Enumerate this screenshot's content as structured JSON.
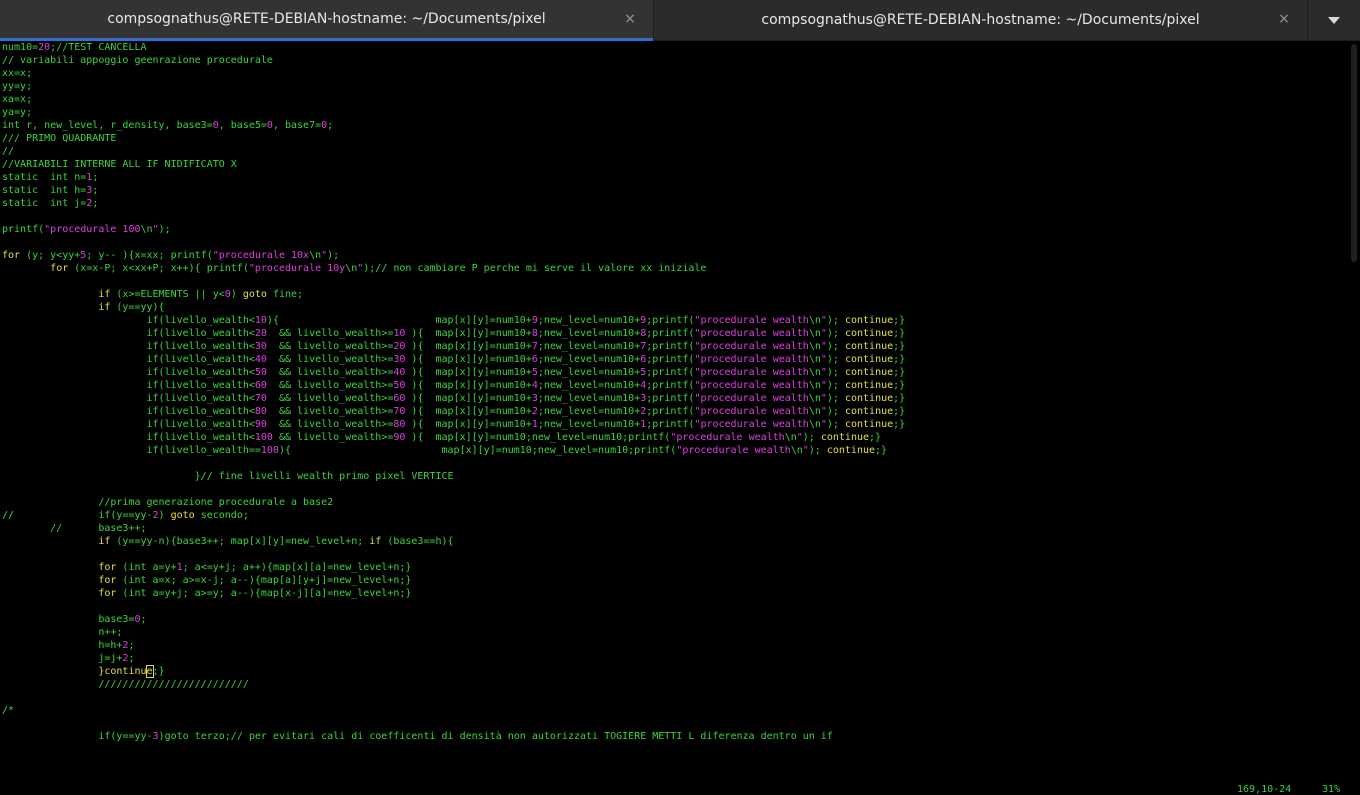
{
  "tabs": [
    {
      "title": "compsognathus@RETE-DEBIAN-hostname: ~/Documents/pixel",
      "close": "×",
      "active": true
    },
    {
      "title": "compsognathus@RETE-DEBIAN-hostname: ~/Documents/pixel",
      "close": "×",
      "active": false
    }
  ],
  "menu_icon": "chevron-down-icon",
  "colors": {
    "default": "#3ad53a",
    "number": "#e03ee0",
    "string": "#e03ee0",
    "keyword": "#e0e040",
    "comment": "#3ad53a",
    "active_tab_underline": "#2f6fd0"
  },
  "editor": {
    "lines": [
      [
        [
          "num10=",
          "d"
        ],
        [
          "20",
          "n"
        ],
        [
          ";//TEST CANCELLA",
          "d"
        ]
      ],
      [
        [
          "// variabili appoggio geenrazione procedurale",
          "d"
        ]
      ],
      [
        [
          "xx=x;",
          "d"
        ]
      ],
      [
        [
          "yy=y;",
          "d"
        ]
      ],
      [
        [
          "xa=x;",
          "d"
        ]
      ],
      [
        [
          "ya=y;",
          "d"
        ]
      ],
      [
        [
          "int r, new_level, r_density, base3=",
          "d"
        ],
        [
          "0",
          "n"
        ],
        [
          ", base5=",
          "d"
        ],
        [
          "0",
          "n"
        ],
        [
          ", base7=",
          "d"
        ],
        [
          "0",
          "n"
        ],
        [
          ";",
          "d"
        ]
      ],
      [
        [
          "/// PRIMO QUADRANTE",
          "d"
        ]
      ],
      [
        [
          "//",
          "d"
        ]
      ],
      [
        [
          "//VARIABILI INTERNE ALL IF NIDIFICATO X",
          "d"
        ]
      ],
      [
        [
          "static  int n=",
          "d"
        ],
        [
          "1",
          "n"
        ],
        [
          ";",
          "d"
        ]
      ],
      [
        [
          "static  int h=",
          "d"
        ],
        [
          "3",
          "n"
        ],
        [
          ";",
          "d"
        ]
      ],
      [
        [
          "static  int j=",
          "d"
        ],
        [
          "2",
          "n"
        ],
        [
          ";",
          "d"
        ]
      ],
      [
        [
          "",
          "d"
        ]
      ],
      [
        [
          "printf(",
          "d"
        ],
        [
          "\"procedurale 100",
          "s"
        ],
        [
          "\\n",
          "d"
        ],
        [
          "\"",
          "s"
        ],
        [
          ");",
          "d"
        ]
      ],
      [
        [
          "",
          "d"
        ]
      ],
      [
        [
          "for",
          "k"
        ],
        [
          " (y; y<yy+",
          "d"
        ],
        [
          "5",
          "n"
        ],
        [
          "; y-- ){x=xx; printf(",
          "d"
        ],
        [
          "\"procedurale 10x",
          "s"
        ],
        [
          "\\n",
          "d"
        ],
        [
          "\"",
          "s"
        ],
        [
          ");",
          "d"
        ]
      ],
      [
        [
          "        ",
          "d"
        ],
        [
          "for",
          "k"
        ],
        [
          " (x=x-P; x<xx+P; x++){ printf(",
          "d"
        ],
        [
          "\"procedurale 10y",
          "s"
        ],
        [
          "\\n",
          "d"
        ],
        [
          "\"",
          "s"
        ],
        [
          ");// non cambiare P perche mi serve il valore xx iniziale",
          "d"
        ]
      ],
      [
        [
          "",
          "d"
        ]
      ],
      [
        [
          "                ",
          "d"
        ],
        [
          "if",
          "k"
        ],
        [
          " (x>=ELEMENTS || y<",
          "d"
        ],
        [
          "0",
          "n"
        ],
        [
          ") ",
          "d"
        ],
        [
          "goto",
          "k"
        ],
        [
          " fine;",
          "d"
        ]
      ],
      [
        [
          "                ",
          "d"
        ],
        [
          "if",
          "k"
        ],
        [
          " (y==yy){",
          "d"
        ]
      ],
      [
        [
          "                        if(livello_wealth<",
          "d"
        ],
        [
          "10",
          "n"
        ],
        [
          "){                          map[x][y]=num10+",
          "d"
        ],
        [
          "9",
          "n"
        ],
        [
          ";new_level=num10+",
          "d"
        ],
        [
          "9",
          "n"
        ],
        [
          ";printf(",
          "d"
        ],
        [
          "\"procedurale wealth",
          "s"
        ],
        [
          "\\n",
          "d"
        ],
        [
          "\"",
          "s"
        ],
        [
          "); ",
          "d"
        ],
        [
          "continue",
          "k"
        ],
        [
          ";}",
          "d"
        ]
      ],
      [
        [
          "                        if(livello_wealth<",
          "d"
        ],
        [
          "20",
          "n"
        ],
        [
          "  && livello_wealth>=",
          "d"
        ],
        [
          "10",
          "n"
        ],
        [
          " ){  map[x][y]=num10+",
          "d"
        ],
        [
          "8",
          "n"
        ],
        [
          ";new_level=num10+",
          "d"
        ],
        [
          "8",
          "n"
        ],
        [
          ";printf(",
          "d"
        ],
        [
          "\"procedurale wealth",
          "s"
        ],
        [
          "\\n",
          "d"
        ],
        [
          "\"",
          "s"
        ],
        [
          "); ",
          "d"
        ],
        [
          "continue",
          "k"
        ],
        [
          ";}",
          "d"
        ]
      ],
      [
        [
          "                        if(livello_wealth<",
          "d"
        ],
        [
          "30",
          "n"
        ],
        [
          "  && livello_wealth>=",
          "d"
        ],
        [
          "20",
          "n"
        ],
        [
          " ){  map[x][y]=num10+",
          "d"
        ],
        [
          "7",
          "n"
        ],
        [
          ";new_level=num10+",
          "d"
        ],
        [
          "7",
          "n"
        ],
        [
          ";printf(",
          "d"
        ],
        [
          "\"procedurale wealth",
          "s"
        ],
        [
          "\\n",
          "d"
        ],
        [
          "\"",
          "s"
        ],
        [
          "); ",
          "d"
        ],
        [
          "continue",
          "k"
        ],
        [
          ";}",
          "d"
        ]
      ],
      [
        [
          "                        if(livello_wealth<",
          "d"
        ],
        [
          "40",
          "n"
        ],
        [
          "  && livello_wealth>=",
          "d"
        ],
        [
          "30",
          "n"
        ],
        [
          " ){  map[x][y]=num10+",
          "d"
        ],
        [
          "6",
          "n"
        ],
        [
          ";new_level=num10+",
          "d"
        ],
        [
          "6",
          "n"
        ],
        [
          ";printf(",
          "d"
        ],
        [
          "\"procedurale wealth",
          "s"
        ],
        [
          "\\n",
          "d"
        ],
        [
          "\"",
          "s"
        ],
        [
          "); ",
          "d"
        ],
        [
          "continue",
          "k"
        ],
        [
          ";}",
          "d"
        ]
      ],
      [
        [
          "                        if(livello_wealth<",
          "d"
        ],
        [
          "50",
          "n"
        ],
        [
          "  && livello_wealth>=",
          "d"
        ],
        [
          "40",
          "n"
        ],
        [
          " ){  map[x][y]=num10+",
          "d"
        ],
        [
          "5",
          "n"
        ],
        [
          ";new_level=num10+",
          "d"
        ],
        [
          "5",
          "n"
        ],
        [
          ";printf(",
          "d"
        ],
        [
          "\"procedurale wealth",
          "s"
        ],
        [
          "\\n",
          "d"
        ],
        [
          "\"",
          "s"
        ],
        [
          "); ",
          "d"
        ],
        [
          "continue",
          "k"
        ],
        [
          ";}",
          "d"
        ]
      ],
      [
        [
          "                        if(livello_wealth<",
          "d"
        ],
        [
          "60",
          "n"
        ],
        [
          "  && livello_wealth>=",
          "d"
        ],
        [
          "50",
          "n"
        ],
        [
          " ){  map[x][y]=num10+",
          "d"
        ],
        [
          "4",
          "n"
        ],
        [
          ";new_level=num10+",
          "d"
        ],
        [
          "4",
          "n"
        ],
        [
          ";printf(",
          "d"
        ],
        [
          "\"procedurale wealth",
          "s"
        ],
        [
          "\\n",
          "d"
        ],
        [
          "\"",
          "s"
        ],
        [
          "); ",
          "d"
        ],
        [
          "continue",
          "k"
        ],
        [
          ";}",
          "d"
        ]
      ],
      [
        [
          "                        if(livello_wealth<",
          "d"
        ],
        [
          "70",
          "n"
        ],
        [
          "  && livello_wealth>=",
          "d"
        ],
        [
          "60",
          "n"
        ],
        [
          " ){  map[x][y]=num10+",
          "d"
        ],
        [
          "3",
          "n"
        ],
        [
          ";new_level=num10+",
          "d"
        ],
        [
          "3",
          "n"
        ],
        [
          ";printf(",
          "d"
        ],
        [
          "\"procedurale wealth",
          "s"
        ],
        [
          "\\n",
          "d"
        ],
        [
          "\"",
          "s"
        ],
        [
          "); ",
          "d"
        ],
        [
          "continue",
          "k"
        ],
        [
          ";}",
          "d"
        ]
      ],
      [
        [
          "                        if(livello_wealth<",
          "d"
        ],
        [
          "80",
          "n"
        ],
        [
          "  && livello_wealth>=",
          "d"
        ],
        [
          "70",
          "n"
        ],
        [
          " ){  map[x][y]=num10+",
          "d"
        ],
        [
          "2",
          "n"
        ],
        [
          ";new_level=num10+",
          "d"
        ],
        [
          "2",
          "n"
        ],
        [
          ";printf(",
          "d"
        ],
        [
          "\"procedurale wealth",
          "s"
        ],
        [
          "\\n",
          "d"
        ],
        [
          "\"",
          "s"
        ],
        [
          "); ",
          "d"
        ],
        [
          "continue",
          "k"
        ],
        [
          ";}",
          "d"
        ]
      ],
      [
        [
          "                        if(livello_wealth<",
          "d"
        ],
        [
          "90",
          "n"
        ],
        [
          "  && livello_wealth>=",
          "d"
        ],
        [
          "80",
          "n"
        ],
        [
          " ){  map[x][y]=num10+",
          "d"
        ],
        [
          "1",
          "n"
        ],
        [
          ";new_level=num10+",
          "d"
        ],
        [
          "1",
          "n"
        ],
        [
          ";printf(",
          "d"
        ],
        [
          "\"procedurale wealth",
          "s"
        ],
        [
          "\\n",
          "d"
        ],
        [
          "\"",
          "s"
        ],
        [
          "); ",
          "d"
        ],
        [
          "continue",
          "k"
        ],
        [
          ";}",
          "d"
        ]
      ],
      [
        [
          "                        if(livello_wealth<",
          "d"
        ],
        [
          "100",
          "n"
        ],
        [
          " && livello_wealth>=",
          "d"
        ],
        [
          "90",
          "n"
        ],
        [
          " ){  map[x][y]=num10;new_level=num10;printf(",
          "d"
        ],
        [
          "\"procedurale wealth",
          "s"
        ],
        [
          "\\n",
          "d"
        ],
        [
          "\"",
          "s"
        ],
        [
          "); ",
          "d"
        ],
        [
          "continue",
          "k"
        ],
        [
          ";}",
          "d"
        ]
      ],
      [
        [
          "                        if(livello_wealth==",
          "d"
        ],
        [
          "100",
          "n"
        ],
        [
          "){                         map[x][y]=num10;new_level=num10;printf(",
          "d"
        ],
        [
          "\"procedurale wealth",
          "s"
        ],
        [
          "\\n",
          "d"
        ],
        [
          "\"",
          "s"
        ],
        [
          "); ",
          "d"
        ],
        [
          "continue",
          "k"
        ],
        [
          ";}",
          "d"
        ]
      ],
      [
        [
          "",
          "d"
        ]
      ],
      [
        [
          "                                }// fine livelli wealth primo pixel VERTICE",
          "d"
        ]
      ],
      [
        [
          "",
          "d"
        ]
      ],
      [
        [
          "                //prima generazione procedurale a base2",
          "d"
        ]
      ],
      [
        [
          "//              if(y==yy-",
          "d"
        ],
        [
          "2",
          "n"
        ],
        [
          ") ",
          "d"
        ],
        [
          "goto",
          "k"
        ],
        [
          " secondo;",
          "d"
        ]
      ],
      [
        [
          "        //      base3++;",
          "d"
        ]
      ],
      [
        [
          "                ",
          "d"
        ],
        [
          "if",
          "k"
        ],
        [
          " (y==yy-n){base3++; map[x][y]=new_level+n; ",
          "d"
        ],
        [
          "if",
          "k"
        ],
        [
          " (base3==h){",
          "d"
        ]
      ],
      [
        [
          "",
          "d"
        ]
      ],
      [
        [
          "                ",
          "d"
        ],
        [
          "for",
          "k"
        ],
        [
          " (int a=y+",
          "d"
        ],
        [
          "1",
          "n"
        ],
        [
          "; a<=y+j; a++){map[x][a]=new_level+n;}",
          "d"
        ]
      ],
      [
        [
          "                ",
          "d"
        ],
        [
          "for",
          "k"
        ],
        [
          " (int a=x; a>=x-j; a--){map[a][y+j]=new_level+n;}",
          "d"
        ]
      ],
      [
        [
          "                ",
          "d"
        ],
        [
          "for",
          "k"
        ],
        [
          " (int a=y+j; a>=y; a--){map[x-j][a]=new_level+n;}",
          "d"
        ]
      ],
      [
        [
          "",
          "d"
        ]
      ],
      [
        [
          "                base3=",
          "d"
        ],
        [
          "0",
          "n"
        ],
        [
          ";",
          "d"
        ]
      ],
      [
        [
          "                n++;",
          "d"
        ]
      ],
      [
        [
          "                h=h+",
          "d"
        ],
        [
          "2",
          "n"
        ],
        [
          ";",
          "d"
        ]
      ],
      [
        [
          "                j=j+",
          "d"
        ],
        [
          "2",
          "n"
        ],
        [
          ";",
          "d"
        ]
      ],
      [
        [
          "                ",
          "d"
        ],
        [
          "}",
          "k"
        ],
        [
          "continu",
          "k"
        ],
        [
          "e",
          "c"
        ],
        [
          ";",
          "d"
        ],
        [
          "}",
          "d"
        ]
      ],
      [
        [
          "                /////////////////////////",
          "d"
        ]
      ],
      [
        [
          "",
          "d"
        ]
      ],
      [
        [
          "/*",
          "d"
        ]
      ],
      [
        [
          "",
          "d"
        ]
      ],
      [
        [
          "                if(y==yy-",
          "d"
        ],
        [
          "3",
          "n"
        ],
        [
          ")goto terzo;// per evitari cali di coefficenti di densità non autorizzati TOGIERE METTI L diferenza dentro un if",
          "d"
        ]
      ]
    ]
  },
  "status": {
    "position": "169,10-24",
    "percent": "31%"
  },
  "scroll": {
    "fraction": 0.31
  }
}
